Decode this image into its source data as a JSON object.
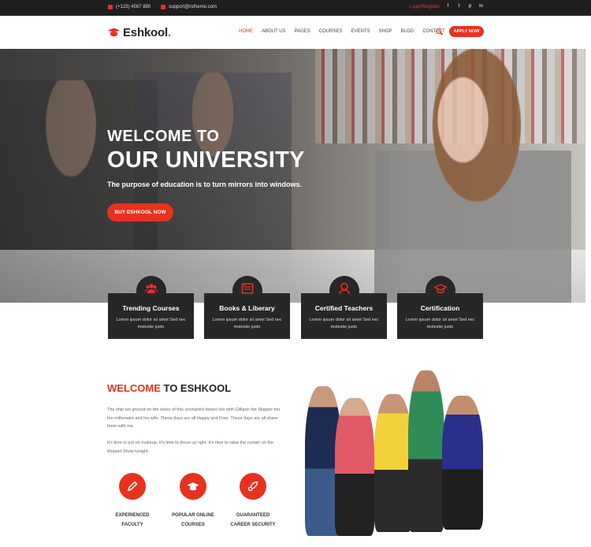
{
  "topbar": {
    "phone": "(+123) 4567 890",
    "email": "support@rstheme.com",
    "login": "Login/Register",
    "social": [
      "f",
      "t",
      "p",
      "in"
    ]
  },
  "header": {
    "logo_text": "Eshkool",
    "logo_dot": ".",
    "nav": [
      "HOME",
      "ABOUT US",
      "PAGES",
      "COURSES",
      "EVENTS",
      "SHOP",
      "BLOG",
      "CONTACT"
    ],
    "apply_label": "APPLY NOW"
  },
  "hero": {
    "line1": "WELCOME TO",
    "line2": "OUR UNIVERSITY",
    "subtitle": "The purpose of education is to turn mirrors into windows.",
    "button": "BUY ESHKOOL NOW"
  },
  "cards": [
    {
      "title": "Trending Courses",
      "desc": "Lorem ipsum dolor sit amet Sed nec molestie justo",
      "icon": "users-icon"
    },
    {
      "title": "Books & Liberary",
      "desc": "Lorem ipsum dolor sit amet Sed nec molestie justo",
      "icon": "book-icon"
    },
    {
      "title": "Certified Teachers",
      "desc": "Lorem ipsum dolor sit amet Sed nec molestie justo",
      "icon": "teacher-icon"
    },
    {
      "title": "Certification",
      "desc": "Lorem ipsum dolor sit amet Sed nec molestie justo",
      "icon": "graduation-cap-icon"
    }
  ],
  "welcome": {
    "title_red": "WELCOME",
    "title_dark": " TO ESHKOOL",
    "p1": "The ship set ground on the shore of this uncharted desert isle with Gilligan the Skipper too the millionaire and his wife. These days are all Happy and Free. These days are all share them with me.",
    "p2": "It's time to put on makeup. It's time to dress up right. It's time to raise the curtain on the Muppet Show tonight.",
    "features": [
      {
        "l1": "EXPERIENCED",
        "l2": "FACULTY",
        "icon": "pencil-icon"
      },
      {
        "l1": "POPULAR ONLINE",
        "l2": "COURSES",
        "icon": "graduation-cap-icon"
      },
      {
        "l1": "GUARANTEED",
        "l2": "CAREER SECURITY",
        "icon": "rocket-icon"
      }
    ]
  },
  "colors": {
    "accent": "#e8321f",
    "dark": "#272727",
    "topbar": "#1f1f1f"
  }
}
